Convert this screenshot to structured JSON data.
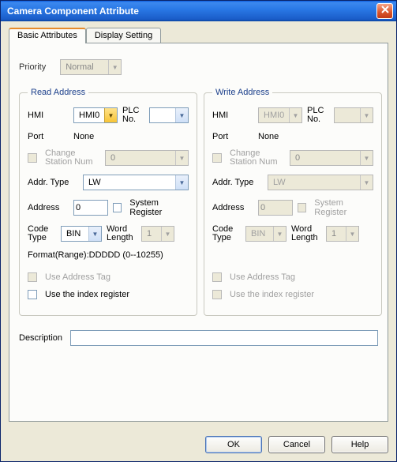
{
  "window": {
    "title": "Camera Component Attribute"
  },
  "tabs": {
    "basic": "Basic Attributes",
    "display": "Display Setting"
  },
  "priority": {
    "label": "Priority",
    "value": "Normal"
  },
  "read": {
    "legend": "Read Address",
    "hmi_label": "HMI",
    "hmi_value": "HMI0",
    "plc_label": "PLC No.",
    "plc_value": "",
    "port_label": "Port",
    "port_value": "None",
    "change_station_label": "Change Station Num",
    "change_station_value": "0",
    "addr_type_label": "Addr. Type",
    "addr_type_value": "LW",
    "address_label": "Address",
    "address_value": "0",
    "system_register_label": "System Register",
    "code_type_label": "Code Type",
    "code_type_value": "BIN",
    "word_length_label": "Word Length",
    "word_length_value": "1",
    "format_line": "Format(Range):DDDDD (0--10255)",
    "use_address_tag_label": "Use Address Tag",
    "use_index_register_label": "Use the index register"
  },
  "write": {
    "legend": "Write Address",
    "hmi_label": "HMI",
    "hmi_value": "HMI0",
    "plc_label": "PLC No.",
    "plc_value": "",
    "port_label": "Port",
    "port_value": "None",
    "change_station_label": "Change Station Num",
    "change_station_value": "0",
    "addr_type_label": "Addr. Type",
    "addr_type_value": "LW",
    "address_label": "Address",
    "address_value": "0",
    "system_register_label": "System Register",
    "code_type_label": "Code Type",
    "code_type_value": "BIN",
    "word_length_label": "Word Length",
    "word_length_value": "1",
    "use_address_tag_label": "Use Address Tag",
    "use_index_register_label": "Use the index register"
  },
  "description": {
    "label": "Description",
    "value": ""
  },
  "buttons": {
    "ok": "OK",
    "cancel": "Cancel",
    "help": "Help"
  }
}
